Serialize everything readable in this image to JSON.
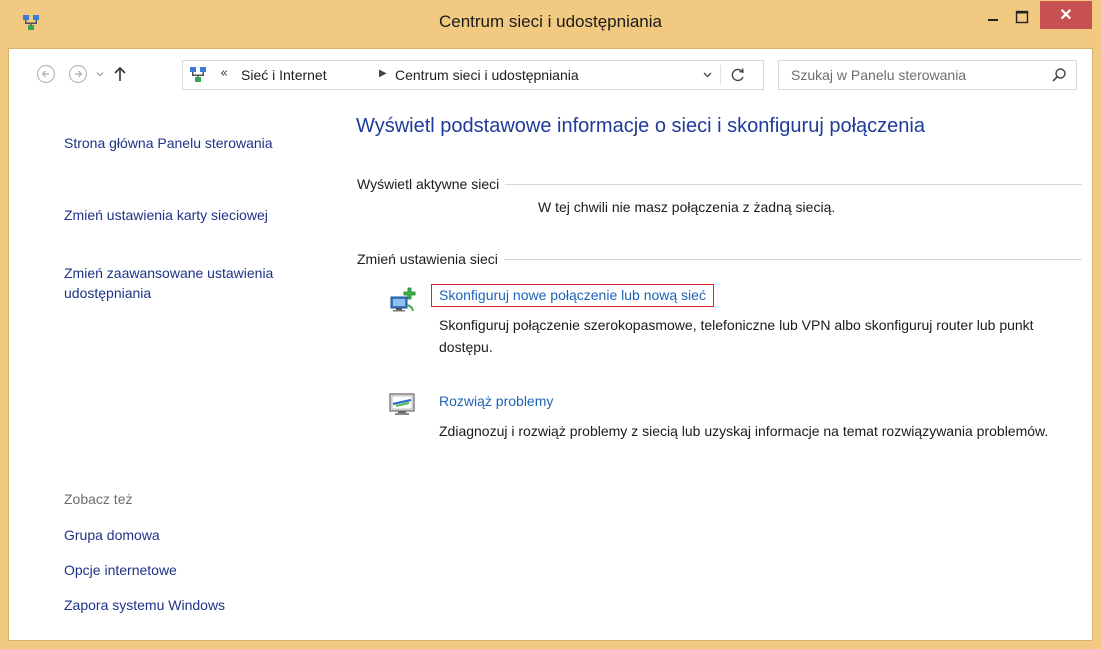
{
  "window": {
    "title": "Centrum sieci i udostępniania",
    "close_label": "✕"
  },
  "address_bar": {
    "overflow": "«",
    "crumbs": [
      "Sieć i Internet",
      "Centrum sieci i udostępniania"
    ]
  },
  "search": {
    "placeholder": "Szukaj w Panelu sterowania"
  },
  "left_pane": {
    "links": [
      "Strona główna Panelu sterowania",
      "Zmień ustawienia karty sieciowej",
      "Zmień zaawansowane ustawienia udostępniania"
    ],
    "see_also_label": "Zobacz też",
    "see_also": [
      "Grupa domowa",
      "Opcje internetowe",
      "Zapora systemu Windows"
    ]
  },
  "main": {
    "title": "Wyświetl podstawowe informacje o sieci i skonfiguruj połączenia",
    "active_networks": {
      "header": "Wyświetl aktywne sieci",
      "message": "W tej chwili nie masz połączenia z żadną siecią."
    },
    "change_settings": {
      "header": "Zmień ustawienia sieci",
      "tasks": [
        {
          "link": "Skonfiguruj nowe połączenie lub nową sieć",
          "description": "Skonfiguruj połączenie szerokopasmowe, telefoniczne lub VPN albo skonfiguruj router lub punkt dostępu.",
          "icon": "network-setup-icon"
        },
        {
          "link": "Rozwiąż problemy",
          "description": "Zdiagnozuj i rozwiąż problemy z siecią lub uzyskaj informacje na temat rozwiązywania problemów.",
          "icon": "troubleshoot-icon"
        }
      ]
    }
  },
  "colors": {
    "frame": "#f2c980",
    "link": "#1e3287",
    "task_link": "#1e63b9",
    "highlight_border": "#e0262b",
    "close_button": "#c75050"
  }
}
